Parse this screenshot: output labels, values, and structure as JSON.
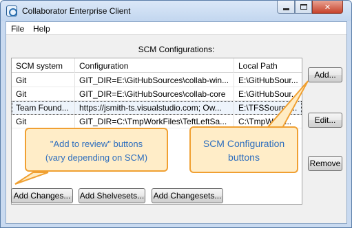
{
  "window": {
    "title": "Collaborator Enterprise Client",
    "controls": {
      "close_glyph": "✕"
    }
  },
  "menu": {
    "file": "File",
    "help": "Help"
  },
  "section_title": "SCM Configurations:",
  "table": {
    "headers": [
      "SCM system",
      "Configuration",
      "Local Path"
    ],
    "rows": [
      [
        "Git",
        "GIT_DIR=E:\\GitHubSources\\collab-win...",
        "E:\\GitHubSour..."
      ],
      [
        "Git",
        "GIT_DIR=E:\\GitHubSources\\collab-core",
        "E:\\GitHubSour..."
      ],
      [
        "Team Found...",
        "https://jsmith-ts.visualstudio.com; Ow...",
        "E:\\TFSSource..."
      ],
      [
        "Git",
        "GIT_DIR=C:\\TmpWorkFiles\\TeftLeftSa...",
        "C:\\TmpWork..."
      ]
    ]
  },
  "buttons": {
    "add": "Add...",
    "edit": "Edit...",
    "remove": "Remove",
    "add_changes": "Add Changes...",
    "add_shelvesets": "Add Shelvesets...",
    "add_changesets": "Add Changesets..."
  },
  "callouts": {
    "review_line1": "\"Add to review\" buttons",
    "review_line2": "(vary depending on SCM)",
    "scm_line1": "SCM Configuration",
    "scm_line2": "buttons"
  },
  "colors": {
    "callout_border": "#f0a032",
    "callout_fill": "#ffecc4",
    "callout_text": "#2f6fbe"
  }
}
